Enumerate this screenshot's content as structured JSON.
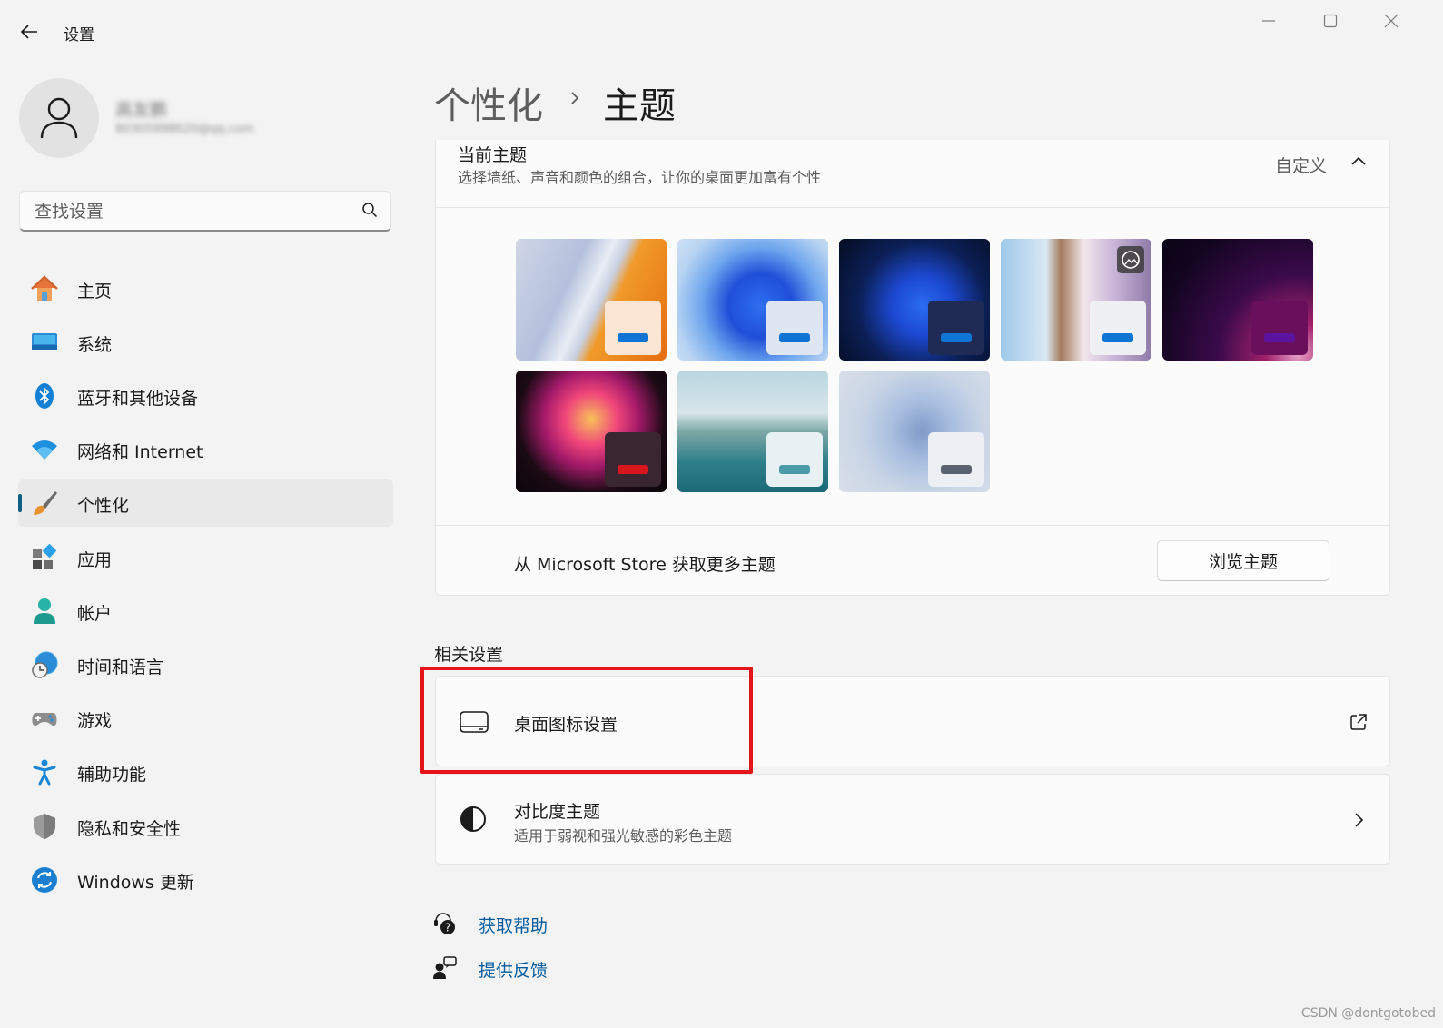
{
  "window": {
    "title": "设置"
  },
  "profile": {
    "name": "高友鹏",
    "email": "80305998620@qq.com"
  },
  "search": {
    "placeholder": "查找设置"
  },
  "nav": [
    {
      "label": "主页"
    },
    {
      "label": "系统"
    },
    {
      "label": "蓝牙和其他设备"
    },
    {
      "label": "网络和 Internet"
    },
    {
      "label": "个性化",
      "active": true
    },
    {
      "label": "应用"
    },
    {
      "label": "帐户"
    },
    {
      "label": "时间和语言"
    },
    {
      "label": "游戏"
    },
    {
      "label": "辅助功能"
    },
    {
      "label": "隐私和安全性"
    },
    {
      "label": "Windows 更新"
    }
  ],
  "breadcrumb": {
    "parent": "个性化",
    "current": "主题"
  },
  "current_theme": {
    "title": "当前主题",
    "description": "选择墙纸、声音和颜色的组合，让你的桌面更加富有个性",
    "value": "自定义",
    "store_text": "从 Microsoft Store 获取更多主题",
    "browse_label": "浏览主题"
  },
  "related": {
    "title": "相关设置",
    "desktop_icons": {
      "title": "桌面图标设置"
    },
    "contrast": {
      "title": "对比度主题",
      "subtitle": "适用于弱视和强光敏感的彩色主题"
    }
  },
  "footer": {
    "help": "获取帮助",
    "feedback": "提供反馈"
  },
  "watermark": "CSDN @dontgotobed",
  "colors": {
    "accent": "#0f5e84",
    "link": "#005a9e",
    "highlight": "#e4141b"
  }
}
